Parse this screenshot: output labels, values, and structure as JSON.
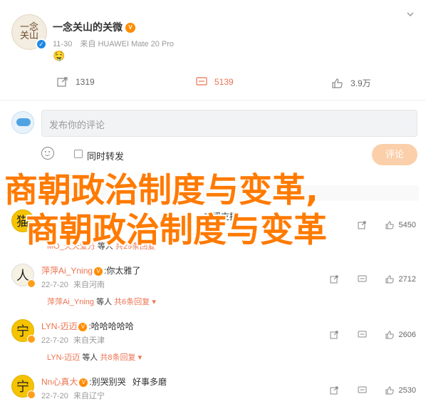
{
  "post": {
    "avatar_text": "一念关山",
    "username": "一念关山的关微",
    "vip_badge": "V",
    "time": "11-30",
    "source": "来自 HUAWEI Mate 20 Pro",
    "emoji": "🤤"
  },
  "actions": {
    "repost": "1319",
    "comment": "5139",
    "like": "3.9万"
  },
  "compose": {
    "placeholder": "发布你的评论",
    "also_repost": "同时转发",
    "submit": "评论"
  },
  "overlay": {
    "line1": "商朝政治制度与变革,",
    "line2": "商朝政治制度与变革"
  },
  "comments": [
    {
      "avatar": "猫",
      "name": "",
      "text": "",
      "time": "",
      "location": "",
      "repost_count": "",
      "like_count": "",
      "reply": {
        "name": "",
        "suffix": "",
        "more": ""
      }
    },
    {
      "avatar": "猫",
      "name": "",
      "text": "支援支援",
      "time": "",
      "location": "",
      "repost_count": "",
      "like_count": "5450",
      "reply": {
        "name": "MO_天天爱万",
        "suffix": "等人",
        "more": "共29条回复"
      }
    },
    {
      "avatar": "人",
      "name": "萍萍Ai_Yning",
      "text": ":你太雅了",
      "time": "22-7-20",
      "location": "来自河南",
      "repost_count": "",
      "like_count": "2712",
      "reply": {
        "name": "萍萍Ai_Yning",
        "suffix": "等人",
        "more": "共6条回复"
      }
    },
    {
      "avatar": "宁",
      "name": "LYN-迈迈",
      "text": ":哈哈哈哈哈",
      "time": "22-7-20",
      "location": "来自天津",
      "repost_count": "",
      "like_count": "2606",
      "reply": {
        "name": "LYN-迈迈",
        "suffix": "等人",
        "more": "共8条回复"
      }
    },
    {
      "avatar": "宁",
      "name": "Nn心真大",
      "text": ":别哭别哭",
      "extra": "好事多磨",
      "time": "22-7-20",
      "location": "来自辽宁",
      "repost_count": "",
      "like_count": "2530",
      "reply": {
        "name": "",
        "suffix": "",
        "more": ""
      }
    }
  ],
  "colors": {
    "accent_orange": "#eb7350",
    "overlay_orange": "#ff7a00",
    "button_disabled": "#fbcfa9",
    "verify_blue": "#1e88e5"
  }
}
